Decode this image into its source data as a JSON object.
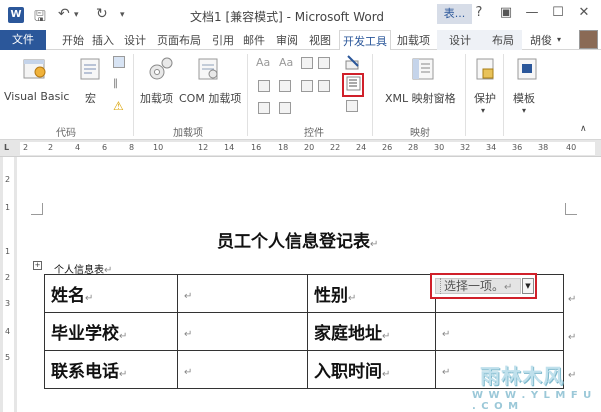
{
  "titlebar": {
    "logo": "W",
    "title": "文档1 [兼容模式] - Microsoft Word",
    "context_tab": "表...",
    "help": "?",
    "restore": "▣",
    "minimize": "—",
    "maximize": "☐",
    "close": "✕"
  },
  "tabs": [
    {
      "label": "文件"
    },
    {
      "label": "开始"
    },
    {
      "label": "插入"
    },
    {
      "label": "设计"
    },
    {
      "label": "页面布局"
    },
    {
      "label": "引用"
    },
    {
      "label": "邮件"
    },
    {
      "label": "审阅"
    },
    {
      "label": "视图"
    },
    {
      "label": "开发工具"
    },
    {
      "label": "加载项"
    },
    {
      "label": "设计"
    },
    {
      "label": "布局"
    },
    {
      "label": "胡俊"
    }
  ],
  "ribbon": {
    "code_group": {
      "label": "代码",
      "visual_basic": "Visual Basic",
      "macro": "宏"
    },
    "addins_group": {
      "label": "加载项",
      "addins": "加载项",
      "com_addins": "COM 加载项"
    },
    "controls_group": {
      "label": "控件"
    },
    "mapping_group": {
      "label": "映射",
      "xml_pane": "XML 映射窗格"
    },
    "protect": {
      "label": "保护"
    },
    "template": {
      "label": "模板"
    }
  },
  "ruler": {
    "numbers": [
      "2",
      "2",
      "4",
      "6",
      "8",
      "10",
      "12",
      "14",
      "16",
      "18",
      "20",
      "22",
      "24",
      "26",
      "28",
      "30",
      "32",
      "34",
      "36",
      "38",
      "40"
    ]
  },
  "vruler": {
    "numbers": [
      "2",
      "1",
      "1",
      "2",
      "3",
      "4",
      "5"
    ]
  },
  "document": {
    "title": "员工个人信息登记表",
    "return_mark": "↵",
    "caption": "个人信息表",
    "rows": [
      {
        "a": "姓名",
        "c": "性别"
      },
      {
        "a": "毕业学校",
        "c": "家庭地址"
      },
      {
        "a": "联系电话",
        "c": "入职时间"
      }
    ],
    "dropdown_placeholder": "选择一项。"
  },
  "watermark": {
    "main": "雨林木风",
    "url": "W W W . Y L M F U . C O M"
  }
}
